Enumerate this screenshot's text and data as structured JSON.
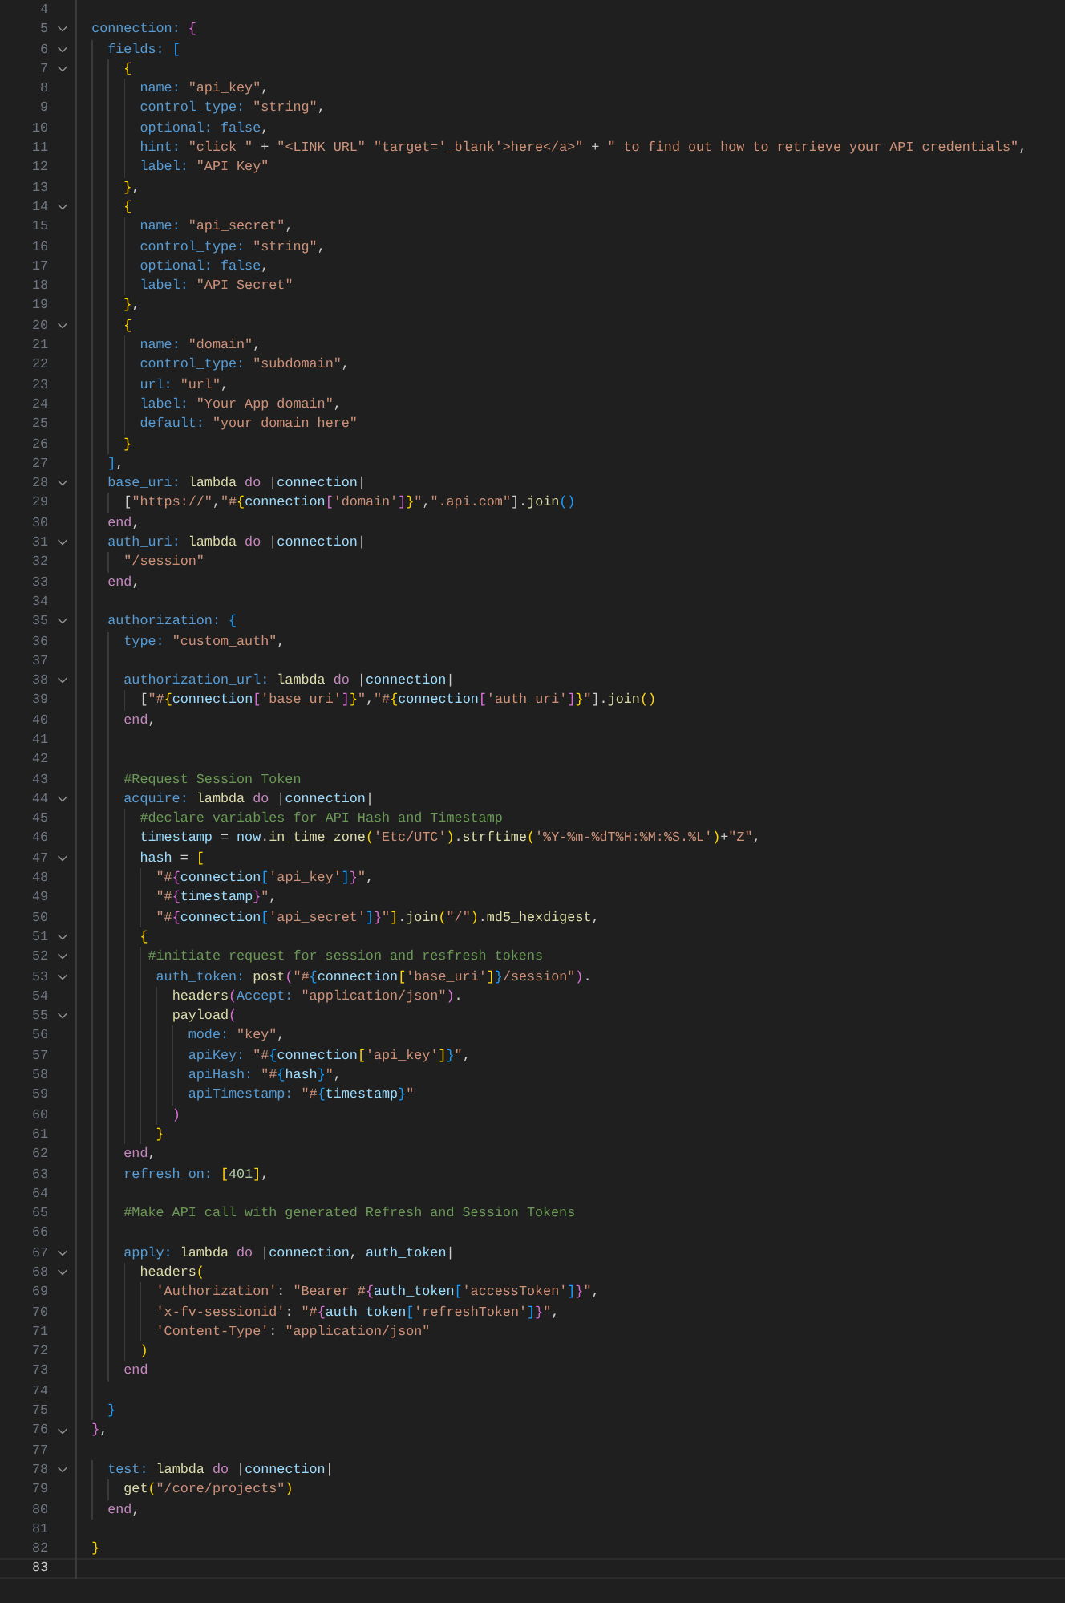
{
  "editor": {
    "lines": [
      {
        "n": "4",
        "fold": false,
        "active": false
      },
      {
        "n": "5",
        "fold": true,
        "active": false,
        "t": [
          {
            "kind": "k",
            "text": "  connection: "
          },
          {
            "kind": "b2",
            "text": "{"
          }
        ]
      },
      {
        "n": "6",
        "fold": true,
        "active": false,
        "t": [
          {
            "kind": "k",
            "text": "    fields: "
          },
          {
            "kind": "b3",
            "text": "["
          }
        ]
      },
      {
        "n": "7",
        "fold": true,
        "active": false,
        "t": [
          {
            "kind": "b1",
            "text": "      {"
          }
        ]
      },
      {
        "n": "8",
        "fold": false,
        "active": false,
        "t": [
          {
            "kind": "k",
            "text": "        name: "
          },
          {
            "kind": "s",
            "text": "\"api_key\""
          },
          {
            "kind": "p",
            "text": ","
          }
        ]
      },
      {
        "n": "9",
        "fold": false,
        "active": false,
        "t": [
          {
            "kind": "k",
            "text": "        control_type: "
          },
          {
            "kind": "s",
            "text": "\"string\""
          },
          {
            "kind": "p",
            "text": ","
          }
        ]
      },
      {
        "n": "10",
        "fold": false,
        "active": false,
        "t": [
          {
            "kind": "k",
            "text": "        optional: "
          },
          {
            "kind": "bo",
            "text": "false"
          },
          {
            "kind": "p",
            "text": ","
          }
        ]
      },
      {
        "n": "11",
        "fold": false,
        "active": false,
        "t": [
          {
            "kind": "k",
            "text": "        hint: "
          },
          {
            "kind": "s",
            "text": "\"click \""
          },
          {
            "kind": "p",
            "text": " + "
          },
          {
            "kind": "s",
            "text": "\"<LINK URL\" \"target='_blank'>here</a>\""
          },
          {
            "kind": "p",
            "text": " + "
          },
          {
            "kind": "s",
            "text": "\" to find out how to retrieve your API credentials\""
          },
          {
            "kind": "p",
            "text": ","
          }
        ]
      },
      {
        "n": "12",
        "fold": false,
        "active": false,
        "t": [
          {
            "kind": "k",
            "text": "        label: "
          },
          {
            "kind": "s",
            "text": "\"API Key\""
          }
        ]
      },
      {
        "n": "13",
        "fold": false,
        "active": false,
        "t": [
          {
            "kind": "b1",
            "text": "      }"
          },
          {
            "kind": "p",
            "text": ","
          }
        ]
      },
      {
        "n": "14",
        "fold": true,
        "active": false,
        "t": [
          {
            "kind": "b1",
            "text": "      {"
          }
        ]
      },
      {
        "n": "15",
        "fold": false,
        "active": false,
        "t": [
          {
            "kind": "k",
            "text": "        name: "
          },
          {
            "kind": "s",
            "text": "\"api_secret\""
          },
          {
            "kind": "p",
            "text": ","
          }
        ]
      },
      {
        "n": "16",
        "fold": false,
        "active": false,
        "t": [
          {
            "kind": "k",
            "text": "        control_type: "
          },
          {
            "kind": "s",
            "text": "\"string\""
          },
          {
            "kind": "p",
            "text": ","
          }
        ]
      },
      {
        "n": "17",
        "fold": false,
        "active": false,
        "t": [
          {
            "kind": "k",
            "text": "        optional: "
          },
          {
            "kind": "bo",
            "text": "false"
          },
          {
            "kind": "p",
            "text": ","
          }
        ]
      },
      {
        "n": "18",
        "fold": false,
        "active": false,
        "t": [
          {
            "kind": "k",
            "text": "        label: "
          },
          {
            "kind": "s",
            "text": "\"API Secret\""
          }
        ]
      },
      {
        "n": "19",
        "fold": false,
        "active": false,
        "t": [
          {
            "kind": "b1",
            "text": "      }"
          },
          {
            "kind": "p",
            "text": ","
          }
        ]
      },
      {
        "n": "20",
        "fold": true,
        "active": false,
        "t": [
          {
            "kind": "b1",
            "text": "      {"
          }
        ]
      },
      {
        "n": "21",
        "fold": false,
        "active": false,
        "t": [
          {
            "kind": "k",
            "text": "        name: "
          },
          {
            "kind": "s",
            "text": "\"domain\""
          },
          {
            "kind": "p",
            "text": ","
          }
        ]
      },
      {
        "n": "22",
        "fold": false,
        "active": false,
        "t": [
          {
            "kind": "k",
            "text": "        control_type: "
          },
          {
            "kind": "s",
            "text": "\"subdomain\""
          },
          {
            "kind": "p",
            "text": ","
          }
        ]
      },
      {
        "n": "23",
        "fold": false,
        "active": false,
        "t": [
          {
            "kind": "k",
            "text": "        url: "
          },
          {
            "kind": "s",
            "text": "\"url\""
          },
          {
            "kind": "p",
            "text": ","
          }
        ]
      },
      {
        "n": "24",
        "fold": false,
        "active": false,
        "t": [
          {
            "kind": "k",
            "text": "        label: "
          },
          {
            "kind": "s",
            "text": "\"Your App domain\""
          },
          {
            "kind": "p",
            "text": ","
          }
        ]
      },
      {
        "n": "25",
        "fold": false,
        "active": false,
        "t": [
          {
            "kind": "k",
            "text": "        default: "
          },
          {
            "kind": "s",
            "text": "\"your domain here\""
          }
        ]
      },
      {
        "n": "26",
        "fold": false,
        "active": false,
        "t": [
          {
            "kind": "b1",
            "text": "      }"
          }
        ]
      },
      {
        "n": "27",
        "fold": false,
        "active": false,
        "t": [
          {
            "kind": "b3",
            "text": "    ]"
          },
          {
            "kind": "p",
            "text": ","
          }
        ]
      },
      {
        "n": "28",
        "fold": true,
        "active": false,
        "t": [
          {
            "kind": "k",
            "text": "    base_uri: "
          },
          {
            "kind": "f",
            "text": "lambda"
          },
          {
            "kind": "kw",
            "text": " do"
          },
          {
            "kind": "p",
            "text": " |"
          },
          {
            "kind": "v",
            "text": "connection"
          },
          {
            "kind": "p",
            "text": "|"
          }
        ]
      },
      {
        "n": "29",
        "fold": false,
        "active": false,
        "t": [
          {
            "kind": "p",
            "text": "      ["
          },
          {
            "kind": "s",
            "text": "\"https://\""
          },
          {
            "kind": "p",
            "text": ","
          },
          {
            "kind": "s",
            "text": "\"#"
          },
          {
            "kind": "b1",
            "text": "{"
          },
          {
            "kind": "v",
            "text": "connection"
          },
          {
            "kind": "b2",
            "text": "["
          },
          {
            "kind": "s",
            "text": "'domain'"
          },
          {
            "kind": "b2",
            "text": "]"
          },
          {
            "kind": "b1",
            "text": "}"
          },
          {
            "kind": "s",
            "text": "\""
          },
          {
            "kind": "p",
            "text": ","
          },
          {
            "kind": "s",
            "text": "\".api.com\""
          },
          {
            "kind": "p",
            "text": "]."
          },
          {
            "kind": "f",
            "text": "join"
          },
          {
            "kind": "b3",
            "text": "()"
          }
        ]
      },
      {
        "n": "30",
        "fold": false,
        "active": false,
        "t": [
          {
            "kind": "kw",
            "text": "    end"
          },
          {
            "kind": "p",
            "text": ","
          }
        ]
      },
      {
        "n": "31",
        "fold": true,
        "active": false,
        "t": [
          {
            "kind": "k",
            "text": "    auth_uri: "
          },
          {
            "kind": "f",
            "text": "lambda"
          },
          {
            "kind": "kw",
            "text": " do"
          },
          {
            "kind": "p",
            "text": " |"
          },
          {
            "kind": "v",
            "text": "connection"
          },
          {
            "kind": "p",
            "text": "|"
          }
        ]
      },
      {
        "n": "32",
        "fold": false,
        "active": false,
        "t": [
          {
            "kind": "s",
            "text": "      \"/session\""
          }
        ]
      },
      {
        "n": "33",
        "fold": false,
        "active": false,
        "t": [
          {
            "kind": "kw",
            "text": "    end"
          },
          {
            "kind": "p",
            "text": ","
          }
        ]
      },
      {
        "n": "34",
        "fold": false,
        "active": false
      },
      {
        "n": "35",
        "fold": true,
        "active": false,
        "t": [
          {
            "kind": "k",
            "text": "    authorization: "
          },
          {
            "kind": "b3",
            "text": "{"
          }
        ]
      },
      {
        "n": "36",
        "fold": false,
        "active": false,
        "t": [
          {
            "kind": "k",
            "text": "      type: "
          },
          {
            "kind": "s",
            "text": "\"custom_auth\""
          },
          {
            "kind": "p",
            "text": ","
          }
        ]
      },
      {
        "n": "37",
        "fold": false,
        "active": false
      },
      {
        "n": "38",
        "fold": true,
        "active": false,
        "t": [
          {
            "kind": "k",
            "text": "      authorization_url: "
          },
          {
            "kind": "f",
            "text": "lambda"
          },
          {
            "kind": "kw",
            "text": " do"
          },
          {
            "kind": "p",
            "text": " |"
          },
          {
            "kind": "v",
            "text": "connection"
          },
          {
            "kind": "p",
            "text": "|"
          }
        ]
      },
      {
        "n": "39",
        "fold": false,
        "active": false,
        "t": [
          {
            "kind": "p",
            "text": "        ["
          },
          {
            "kind": "s",
            "text": "\"#"
          },
          {
            "kind": "b1",
            "text": "{"
          },
          {
            "kind": "v",
            "text": "connection"
          },
          {
            "kind": "b2",
            "text": "["
          },
          {
            "kind": "s",
            "text": "'base_uri'"
          },
          {
            "kind": "b2",
            "text": "]"
          },
          {
            "kind": "b1",
            "text": "}"
          },
          {
            "kind": "s",
            "text": "\""
          },
          {
            "kind": "p",
            "text": ","
          },
          {
            "kind": "s",
            "text": "\"#"
          },
          {
            "kind": "b1",
            "text": "{"
          },
          {
            "kind": "v",
            "text": "connection"
          },
          {
            "kind": "b2",
            "text": "["
          },
          {
            "kind": "s",
            "text": "'auth_uri'"
          },
          {
            "kind": "b2",
            "text": "]"
          },
          {
            "kind": "b1",
            "text": "}"
          },
          {
            "kind": "s",
            "text": "\""
          },
          {
            "kind": "p",
            "text": "]."
          },
          {
            "kind": "f",
            "text": "join"
          },
          {
            "kind": "b1",
            "text": "()"
          }
        ]
      },
      {
        "n": "40",
        "fold": false,
        "active": false,
        "t": [
          {
            "kind": "kw",
            "text": "      end"
          },
          {
            "kind": "p",
            "text": ","
          }
        ]
      },
      {
        "n": "41",
        "fold": false,
        "active": false
      },
      {
        "n": "42",
        "fold": false,
        "active": false
      },
      {
        "n": "43",
        "fold": false,
        "active": false,
        "t": [
          {
            "kind": "c",
            "text": "      #Request Session Token"
          }
        ]
      },
      {
        "n": "44",
        "fold": true,
        "active": false,
        "t": [
          {
            "kind": "k",
            "text": "      acquire: "
          },
          {
            "kind": "f",
            "text": "lambda"
          },
          {
            "kind": "kw",
            "text": " do"
          },
          {
            "kind": "p",
            "text": " |"
          },
          {
            "kind": "v",
            "text": "connection"
          },
          {
            "kind": "p",
            "text": "|"
          }
        ]
      },
      {
        "n": "45",
        "fold": false,
        "active": false,
        "t": [
          {
            "kind": "c",
            "text": "        #declare variables for API Hash and Timestamp"
          }
        ]
      },
      {
        "n": "46",
        "fold": false,
        "active": false,
        "t": [
          {
            "kind": "v",
            "text": "        timestamp"
          },
          {
            "kind": "p",
            "text": " = "
          },
          {
            "kind": "v",
            "text": "now"
          },
          {
            "kind": "p",
            "text": "."
          },
          {
            "kind": "f",
            "text": "in_time_zone"
          },
          {
            "kind": "b1",
            "text": "("
          },
          {
            "kind": "s",
            "text": "'Etc/UTC'"
          },
          {
            "kind": "b1",
            "text": ")"
          },
          {
            "kind": "p",
            "text": "."
          },
          {
            "kind": "f",
            "text": "strftime"
          },
          {
            "kind": "b1",
            "text": "("
          },
          {
            "kind": "s",
            "text": "'%Y-%m-%dT%H:%M:%S.%L'"
          },
          {
            "kind": "b1",
            "text": ")"
          },
          {
            "kind": "p",
            "text": "+"
          },
          {
            "kind": "s",
            "text": "\"Z\""
          },
          {
            "kind": "p",
            "text": ","
          }
        ]
      },
      {
        "n": "47",
        "fold": true,
        "active": false,
        "t": [
          {
            "kind": "v",
            "text": "        hash"
          },
          {
            "kind": "p",
            "text": " = "
          },
          {
            "kind": "b1",
            "text": "["
          }
        ]
      },
      {
        "n": "48",
        "fold": false,
        "active": false,
        "t": [
          {
            "kind": "s",
            "text": "          \"#"
          },
          {
            "kind": "b2",
            "text": "{"
          },
          {
            "kind": "v",
            "text": "connection"
          },
          {
            "kind": "b3",
            "text": "["
          },
          {
            "kind": "s",
            "text": "'api_key'"
          },
          {
            "kind": "b3",
            "text": "]"
          },
          {
            "kind": "b2",
            "text": "}"
          },
          {
            "kind": "s",
            "text": "\""
          },
          {
            "kind": "p",
            "text": ","
          }
        ]
      },
      {
        "n": "49",
        "fold": false,
        "active": false,
        "t": [
          {
            "kind": "s",
            "text": "          \"#"
          },
          {
            "kind": "b2",
            "text": "{"
          },
          {
            "kind": "v",
            "text": "timestamp"
          },
          {
            "kind": "b2",
            "text": "}"
          },
          {
            "kind": "s",
            "text": "\""
          },
          {
            "kind": "p",
            "text": ","
          }
        ]
      },
      {
        "n": "50",
        "fold": false,
        "active": false,
        "t": [
          {
            "kind": "s",
            "text": "          \"#"
          },
          {
            "kind": "b2",
            "text": "{"
          },
          {
            "kind": "v",
            "text": "connection"
          },
          {
            "kind": "b3",
            "text": "["
          },
          {
            "kind": "s",
            "text": "'api_secret'"
          },
          {
            "kind": "b3",
            "text": "]"
          },
          {
            "kind": "b2",
            "text": "}"
          },
          {
            "kind": "s",
            "text": "\""
          },
          {
            "kind": "b1",
            "text": "]"
          },
          {
            "kind": "p",
            "text": "."
          },
          {
            "kind": "f",
            "text": "join"
          },
          {
            "kind": "b1",
            "text": "("
          },
          {
            "kind": "s",
            "text": "\"/\""
          },
          {
            "kind": "b1",
            "text": ")"
          },
          {
            "kind": "p",
            "text": "."
          },
          {
            "kind": "f",
            "text": "md5_hexdigest"
          },
          {
            "kind": "p",
            "text": ","
          }
        ]
      },
      {
        "n": "51",
        "fold": true,
        "active": false,
        "t": [
          {
            "kind": "b1",
            "text": "        {"
          }
        ]
      },
      {
        "n": "52",
        "fold": true,
        "active": false,
        "t": [
          {
            "kind": "c",
            "text": "         #initiate request for session and resfresh tokens"
          }
        ]
      },
      {
        "n": "53",
        "fold": true,
        "active": false,
        "t": [
          {
            "kind": "k",
            "text": "          auth_token: "
          },
          {
            "kind": "f",
            "text": "post"
          },
          {
            "kind": "b2",
            "text": "("
          },
          {
            "kind": "s",
            "text": "\"#"
          },
          {
            "kind": "b3",
            "text": "{"
          },
          {
            "kind": "v",
            "text": "connection"
          },
          {
            "kind": "b1",
            "text": "["
          },
          {
            "kind": "s",
            "text": "'base_uri'"
          },
          {
            "kind": "b1",
            "text": "]"
          },
          {
            "kind": "b3",
            "text": "}"
          },
          {
            "kind": "s",
            "text": "/session\""
          },
          {
            "kind": "b2",
            "text": ")"
          },
          {
            "kind": "p",
            "text": "."
          }
        ]
      },
      {
        "n": "54",
        "fold": false,
        "active": false,
        "t": [
          {
            "kind": "f",
            "text": "            headers"
          },
          {
            "kind": "b2",
            "text": "("
          },
          {
            "kind": "k",
            "text": "Accept: "
          },
          {
            "kind": "s",
            "text": "\"application/json\""
          },
          {
            "kind": "b2",
            "text": ")"
          },
          {
            "kind": "p",
            "text": "."
          }
        ]
      },
      {
        "n": "55",
        "fold": true,
        "active": false,
        "t": [
          {
            "kind": "f",
            "text": "            payload"
          },
          {
            "kind": "b2",
            "text": "("
          }
        ]
      },
      {
        "n": "56",
        "fold": false,
        "active": false,
        "t": [
          {
            "kind": "k",
            "text": "              mode: "
          },
          {
            "kind": "s",
            "text": "\"key\""
          },
          {
            "kind": "p",
            "text": ","
          }
        ]
      },
      {
        "n": "57",
        "fold": false,
        "active": false,
        "t": [
          {
            "kind": "k",
            "text": "              apiKey: "
          },
          {
            "kind": "s",
            "text": "\"#"
          },
          {
            "kind": "b3",
            "text": "{"
          },
          {
            "kind": "v",
            "text": "connection"
          },
          {
            "kind": "b1",
            "text": "["
          },
          {
            "kind": "s",
            "text": "'api_key'"
          },
          {
            "kind": "b1",
            "text": "]"
          },
          {
            "kind": "b3",
            "text": "}"
          },
          {
            "kind": "s",
            "text": "\""
          },
          {
            "kind": "p",
            "text": ","
          }
        ]
      },
      {
        "n": "58",
        "fold": false,
        "active": false,
        "t": [
          {
            "kind": "k",
            "text": "              apiHash: "
          },
          {
            "kind": "s",
            "text": "\"#"
          },
          {
            "kind": "b3",
            "text": "{"
          },
          {
            "kind": "v",
            "text": "hash"
          },
          {
            "kind": "b3",
            "text": "}"
          },
          {
            "kind": "s",
            "text": "\""
          },
          {
            "kind": "p",
            "text": ","
          }
        ]
      },
      {
        "n": "59",
        "fold": false,
        "active": false,
        "t": [
          {
            "kind": "k",
            "text": "              apiTimestamp: "
          },
          {
            "kind": "s",
            "text": "\"#"
          },
          {
            "kind": "b3",
            "text": "{"
          },
          {
            "kind": "v",
            "text": "timestamp"
          },
          {
            "kind": "b3",
            "text": "}"
          },
          {
            "kind": "s",
            "text": "\""
          }
        ]
      },
      {
        "n": "60",
        "fold": false,
        "active": false,
        "t": [
          {
            "kind": "b2",
            "text": "            )"
          }
        ]
      },
      {
        "n": "61",
        "fold": false,
        "active": false,
        "t": [
          {
            "kind": "b1",
            "text": "          }"
          }
        ]
      },
      {
        "n": "62",
        "fold": false,
        "active": false,
        "t": [
          {
            "kind": "kw",
            "text": "      end"
          },
          {
            "kind": "p",
            "text": ","
          }
        ]
      },
      {
        "n": "63",
        "fold": false,
        "active": false,
        "t": [
          {
            "kind": "k",
            "text": "      refresh_on: "
          },
          {
            "kind": "b1",
            "text": "["
          },
          {
            "kind": "n",
            "text": "401"
          },
          {
            "kind": "b1",
            "text": "]"
          },
          {
            "kind": "p",
            "text": ","
          }
        ]
      },
      {
        "n": "64",
        "fold": false,
        "active": false
      },
      {
        "n": "65",
        "fold": false,
        "active": false,
        "t": [
          {
            "kind": "c",
            "text": "      #Make API call with generated Refresh and Session Tokens"
          }
        ]
      },
      {
        "n": "66",
        "fold": false,
        "active": false
      },
      {
        "n": "67",
        "fold": true,
        "active": false,
        "t": [
          {
            "kind": "k",
            "text": "      apply: "
          },
          {
            "kind": "f",
            "text": "lambda"
          },
          {
            "kind": "kw",
            "text": " do"
          },
          {
            "kind": "p",
            "text": " |"
          },
          {
            "kind": "v",
            "text": "connection"
          },
          {
            "kind": "p",
            "text": ", "
          },
          {
            "kind": "v",
            "text": "auth_token"
          },
          {
            "kind": "p",
            "text": "|"
          }
        ]
      },
      {
        "n": "68",
        "fold": true,
        "active": false,
        "t": [
          {
            "kind": "f",
            "text": "        headers"
          },
          {
            "kind": "b1",
            "text": "("
          }
        ]
      },
      {
        "n": "69",
        "fold": false,
        "active": false,
        "t": [
          {
            "kind": "s",
            "text": "          'Authorization'"
          },
          {
            "kind": "p",
            "text": ": "
          },
          {
            "kind": "s",
            "text": "\"Bearer #"
          },
          {
            "kind": "b2",
            "text": "{"
          },
          {
            "kind": "v",
            "text": "auth_token"
          },
          {
            "kind": "b3",
            "text": "["
          },
          {
            "kind": "s",
            "text": "'accessToken'"
          },
          {
            "kind": "b3",
            "text": "]"
          },
          {
            "kind": "b2",
            "text": "}"
          },
          {
            "kind": "s",
            "text": "\""
          },
          {
            "kind": "p",
            "text": ","
          }
        ]
      },
      {
        "n": "70",
        "fold": false,
        "active": false,
        "t": [
          {
            "kind": "s",
            "text": "          'x-fv-sessionid'"
          },
          {
            "kind": "p",
            "text": ": "
          },
          {
            "kind": "s",
            "text": "\"#"
          },
          {
            "kind": "b2",
            "text": "{"
          },
          {
            "kind": "v",
            "text": "auth_token"
          },
          {
            "kind": "b3",
            "text": "["
          },
          {
            "kind": "s",
            "text": "'refreshToken'"
          },
          {
            "kind": "b3",
            "text": "]"
          },
          {
            "kind": "b2",
            "text": "}"
          },
          {
            "kind": "s",
            "text": "\""
          },
          {
            "kind": "p",
            "text": ","
          }
        ]
      },
      {
        "n": "71",
        "fold": false,
        "active": false,
        "t": [
          {
            "kind": "s",
            "text": "          'Content-Type'"
          },
          {
            "kind": "p",
            "text": ": "
          },
          {
            "kind": "s",
            "text": "\"application/json\""
          }
        ]
      },
      {
        "n": "72",
        "fold": false,
        "active": false,
        "t": [
          {
            "kind": "b1",
            "text": "        )"
          }
        ]
      },
      {
        "n": "73",
        "fold": false,
        "active": false,
        "t": [
          {
            "kind": "kw",
            "text": "      end"
          }
        ]
      },
      {
        "n": "74",
        "fold": false,
        "active": false
      },
      {
        "n": "75",
        "fold": false,
        "active": false,
        "t": [
          {
            "kind": "b3",
            "text": "    }"
          }
        ]
      },
      {
        "n": "76",
        "fold": true,
        "active": false,
        "t": [
          {
            "kind": "b2",
            "text": "  }"
          },
          {
            "kind": "p",
            "text": ","
          }
        ]
      },
      {
        "n": "77",
        "fold": false,
        "active": false
      },
      {
        "n": "78",
        "fold": true,
        "active": false,
        "t": [
          {
            "kind": "k",
            "text": "    test: "
          },
          {
            "kind": "f",
            "text": "lambda"
          },
          {
            "kind": "kw",
            "text": " do"
          },
          {
            "kind": "p",
            "text": " |"
          },
          {
            "kind": "v",
            "text": "connection"
          },
          {
            "kind": "p",
            "text": "|"
          }
        ]
      },
      {
        "n": "79",
        "fold": false,
        "active": false,
        "t": [
          {
            "kind": "f",
            "text": "      get"
          },
          {
            "kind": "b1",
            "text": "("
          },
          {
            "kind": "s",
            "text": "\"/core/projects\""
          },
          {
            "kind": "b1",
            "text": ")"
          }
        ]
      },
      {
        "n": "80",
        "fold": false,
        "active": false,
        "t": [
          {
            "kind": "kw",
            "text": "    end"
          },
          {
            "kind": "p",
            "text": ","
          }
        ]
      },
      {
        "n": "81",
        "fold": false,
        "active": false
      },
      {
        "n": "82",
        "fold": false,
        "active": false,
        "t": [
          {
            "kind": "b1",
            "text": "  }"
          }
        ]
      },
      {
        "n": "83",
        "fold": false,
        "active": true
      }
    ]
  }
}
